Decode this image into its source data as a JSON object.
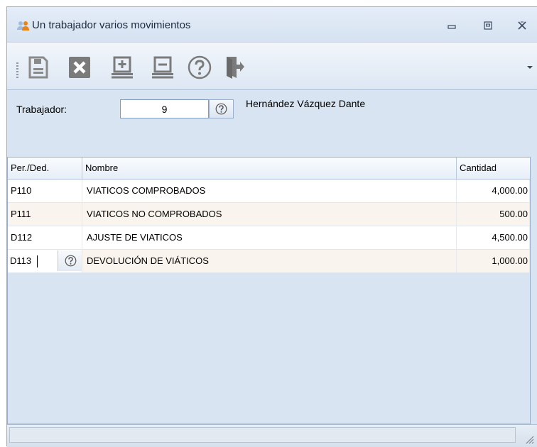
{
  "window": {
    "title": "Un trabajador varios movimientos",
    "title_icon": "users-icon",
    "controls": [
      "minimize-icon",
      "restore-icon",
      "close-icon"
    ]
  },
  "toolbar": {
    "buttons": [
      {
        "name": "save-button",
        "icon": "save-icon"
      },
      {
        "name": "delete-button",
        "icon": "delete-icon"
      },
      {
        "name": "add-row-button",
        "icon": "add-row-icon"
      },
      {
        "name": "remove-row-button",
        "icon": "remove-row-icon"
      },
      {
        "name": "help-button",
        "icon": "help-icon"
      },
      {
        "name": "exit-button",
        "icon": "exit-icon"
      }
    ]
  },
  "worker": {
    "label": "Trabajador:",
    "value": "9",
    "name": "Hernández Vázquez Dante"
  },
  "grid": {
    "columns": [
      "Per./Ded.",
      "Nombre",
      "Cantidad"
    ],
    "rows": [
      {
        "code": "P110",
        "name": "VIATICOS COMPROBADOS",
        "amount": "4,000.00"
      },
      {
        "code": "P111",
        "name": "VIATICOS NO COMPROBADOS",
        "amount": "500.00"
      },
      {
        "code": "D112",
        "name": "AJUSTE DE VIATICOS",
        "amount": "4,500.00"
      },
      {
        "code": "D113",
        "name": "DEVOLUCIÓN DE VIÁTICOS",
        "amount": "1,000.00"
      }
    ]
  },
  "colors": {
    "window_bg": "#d8e4f2",
    "icon_gray": "#7a7a7a",
    "title_icon_orange": "#e8831a",
    "title_icon_blue": "#8fb3d9"
  }
}
